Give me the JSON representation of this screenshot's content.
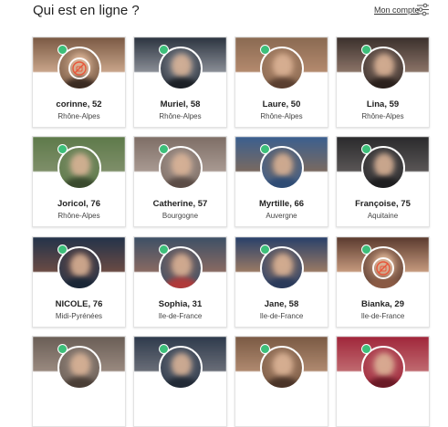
{
  "header": {
    "title": "Qui est en ligne ?",
    "account_label": "Mon compte",
    "settings_icon": "sliders-icon"
  },
  "colors": {
    "online": "#3dbf7a",
    "photo_badge": "#e8563a"
  },
  "profiles": [
    {
      "name": "corinne, 52",
      "region": "Rhône-Alpes",
      "banner": "#7a5a44",
      "avatar": "#c9a58a",
      "shirt": "#3a2b22",
      "badge": true
    },
    {
      "name": "Muriel, 58",
      "region": "Rhône-Alpes",
      "banner": "#2c3440",
      "avatar": "#8a8e96",
      "shirt": "#1c2026",
      "badge": false
    },
    {
      "name": "Laure, 50",
      "region": "Rhône-Alpes",
      "banner": "#8a6a52",
      "avatar": "#b48a6e",
      "shirt": "#5a3f30",
      "badge": false
    },
    {
      "name": "Lina, 59",
      "region": "Rhône-Alpes",
      "banner": "#3a302c",
      "avatar": "#8c7468",
      "shirt": "#2a201c",
      "badge": false
    },
    {
      "name": "Joricol, 76",
      "region": "Rhône-Alpes",
      "banner": "#5e7a4a",
      "avatar": "#7f8f6a",
      "shirt": "#3a4a2e",
      "badge": false
    },
    {
      "name": "Catherine, 57",
      "region": "Bourgogne",
      "banner": "#7e6e66",
      "avatar": "#a99a92",
      "shirt": "#5b4c46",
      "badge": false
    },
    {
      "name": "Myrtille, 66",
      "region": "Auvergne",
      "banner": "#3b5f8f",
      "avatar": "#7a6a60",
      "shirt": "#2f4c74",
      "badge": false
    },
    {
      "name": "Françoise, 75",
      "region": "Aquitaine",
      "banner": "#2a2a2c",
      "avatar": "#5a5656",
      "shirt": "#1e1e20",
      "badge": false
    },
    {
      "name": "NICOLE, 76",
      "region": "Midi-Pyrénées",
      "banner": "#23334a",
      "avatar": "#6b4b44",
      "shirt": "#1a2636",
      "badge": false
    },
    {
      "name": "Sophia, 31",
      "region": "Ile-de-France",
      "banner": "#3e5066",
      "avatar": "#8a6a62",
      "shirt": "#b03a3a",
      "badge": false
    },
    {
      "name": "Jane, 58",
      "region": "Ile-de-France",
      "banner": "#28406a",
      "avatar": "#9a7a64",
      "shirt": "#2a3a5a",
      "badge": false
    },
    {
      "name": "Bianka, 29",
      "region": "Ile-de-France",
      "banner": "#5a3a2e",
      "avatar": "#c69a7e",
      "shirt": "#8a5a44",
      "badge": true
    },
    {
      "name": "",
      "region": "",
      "banner": "#6a5e56",
      "avatar": "#9a8a80",
      "shirt": "#4a3e36",
      "badge": false
    },
    {
      "name": "",
      "region": "",
      "banner": "#2e3a4c",
      "avatar": "#6a6e78",
      "shirt": "#222a36",
      "badge": false
    },
    {
      "name": "",
      "region": "",
      "banner": "#7a5a44",
      "avatar": "#b08a70",
      "shirt": "#4a3428",
      "badge": false
    },
    {
      "name": "",
      "region": "",
      "banner": "#a0263a",
      "avatar": "#c06a70",
      "shirt": "#6a1a26",
      "badge": false
    }
  ]
}
